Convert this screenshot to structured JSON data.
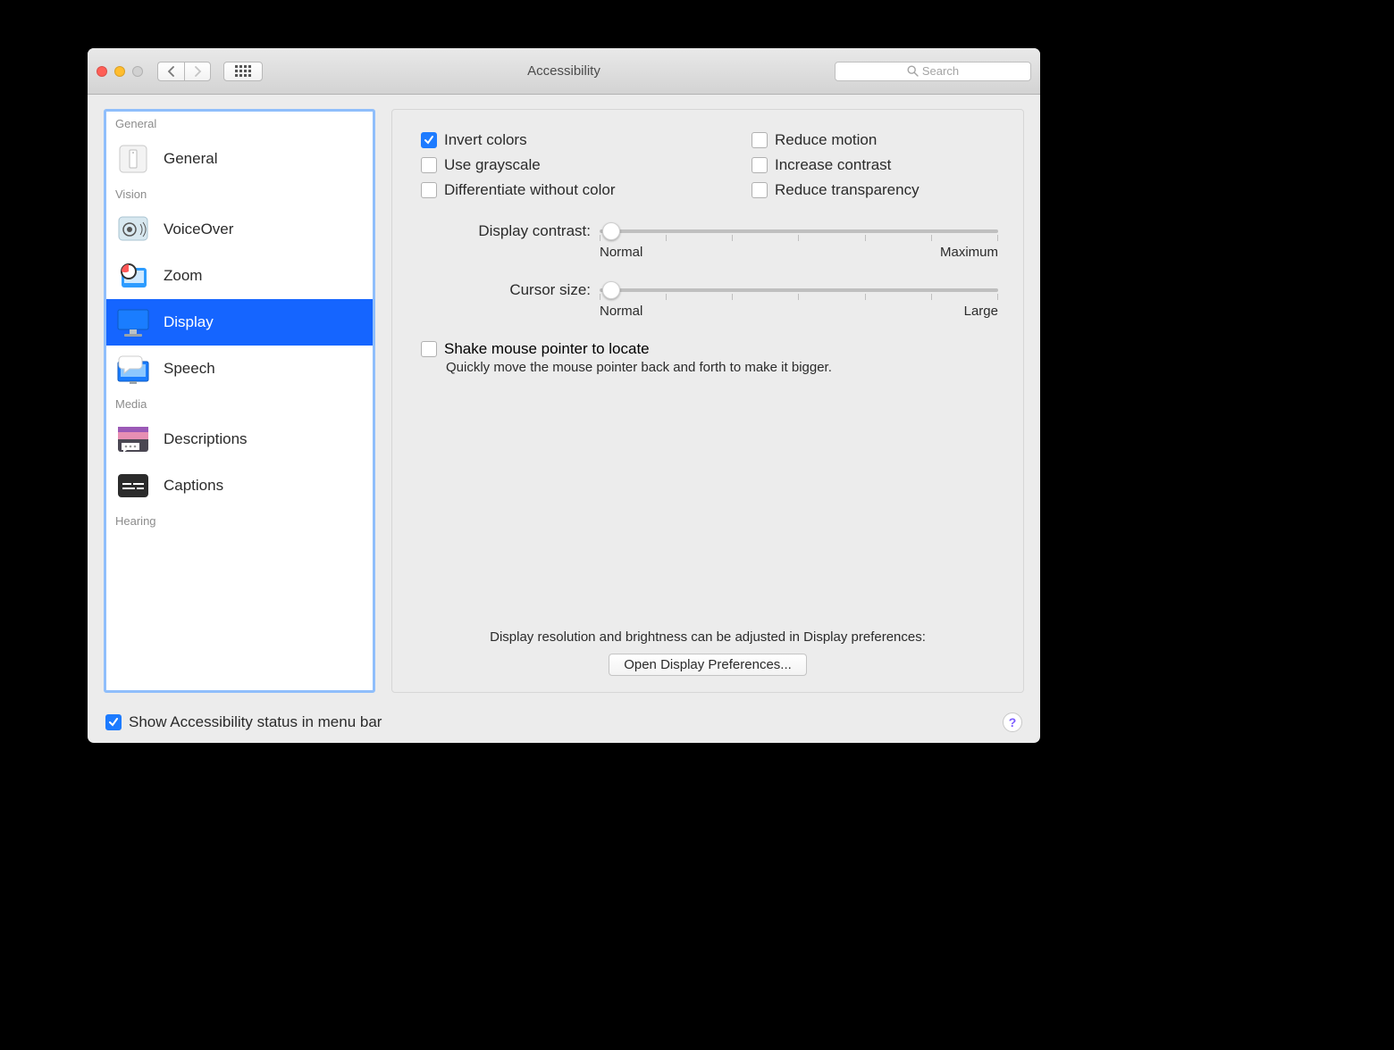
{
  "window": {
    "title": "Accessibility"
  },
  "search": {
    "placeholder": "Search"
  },
  "sidebar": {
    "sections": [
      {
        "header": "General",
        "items": [
          {
            "label": "General"
          }
        ]
      },
      {
        "header": "Vision",
        "items": [
          {
            "label": "VoiceOver"
          },
          {
            "label": "Zoom"
          },
          {
            "label": "Display"
          },
          {
            "label": "Speech"
          }
        ]
      },
      {
        "header": "Media",
        "items": [
          {
            "label": "Descriptions"
          },
          {
            "label": "Captions"
          }
        ]
      },
      {
        "header": "Hearing",
        "items": []
      }
    ]
  },
  "checks": {
    "invert_colors": "Invert colors",
    "use_grayscale": "Use grayscale",
    "diff_without_color": "Differentiate without color",
    "reduce_motion": "Reduce motion",
    "increase_contrast": "Increase contrast",
    "reduce_transparency": "Reduce transparency"
  },
  "sliders": {
    "contrast": {
      "label": "Display contrast:",
      "min_label": "Normal",
      "max_label": "Maximum"
    },
    "cursor": {
      "label": "Cursor size:",
      "min_label": "Normal",
      "max_label": "Large"
    }
  },
  "shake": {
    "label": "Shake mouse pointer to locate",
    "hint": "Quickly move the mouse pointer back and forth to make it bigger."
  },
  "footer": {
    "msg": "Display resolution and brightness can be adjusted in Display preferences:",
    "button": "Open Display Preferences..."
  },
  "bottom": {
    "label": "Show Accessibility status in menu bar"
  }
}
